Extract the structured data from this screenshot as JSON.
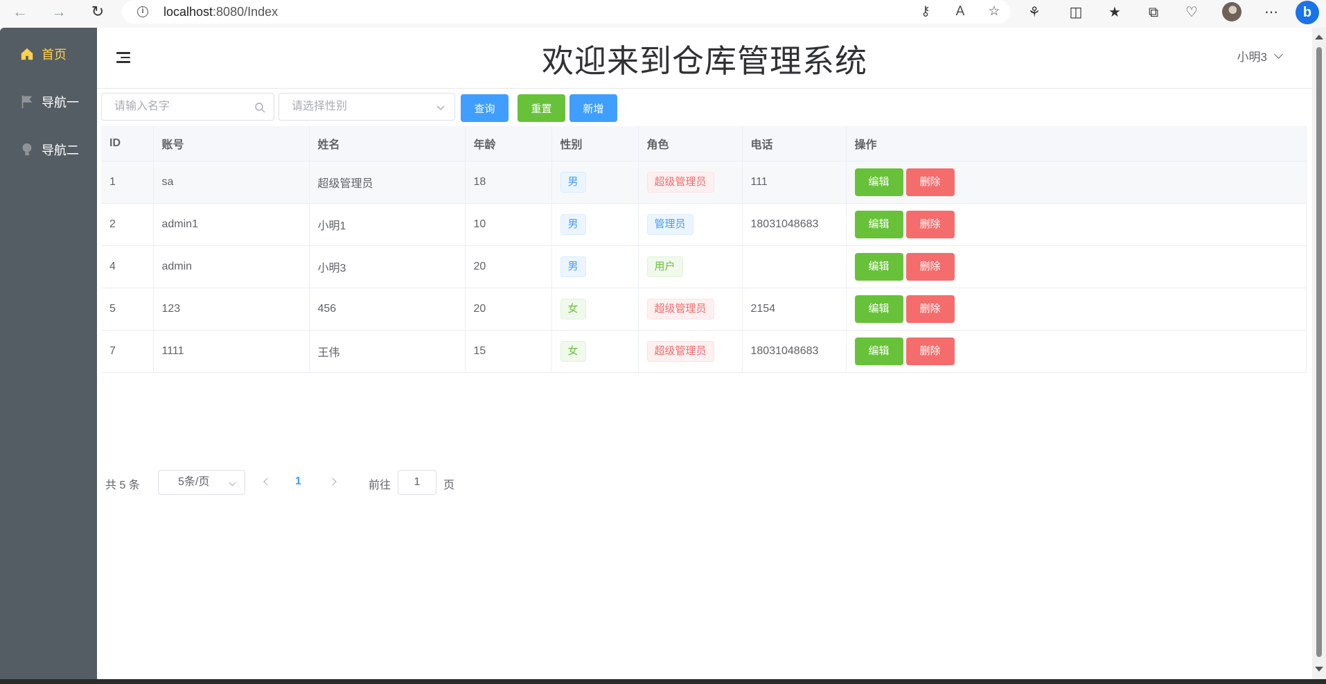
{
  "browser": {
    "url_host": "localhost",
    "url_rest": ":8080/Index"
  },
  "sidebar": {
    "items": [
      {
        "label": "首页",
        "icon": "home-icon",
        "active": true
      },
      {
        "label": "导航一",
        "icon": "flag-icon",
        "active": false
      },
      {
        "label": "导航二",
        "icon": "lightbulb-icon",
        "active": false
      }
    ],
    "active_color": "#ffd04b",
    "bg_color": "#545c64"
  },
  "header": {
    "title": "欢迎来到仓库管理系统",
    "user": "小明3"
  },
  "toolbar": {
    "search_placeholder": "请输入名字",
    "sex_placeholder": "请选择性别",
    "query_label": "查询",
    "reset_label": "重置",
    "add_label": "新增"
  },
  "table": {
    "columns": [
      "ID",
      "账号",
      "姓名",
      "年龄",
      "性别",
      "角色",
      "电话",
      "操作"
    ],
    "rows": [
      {
        "id": "1",
        "account": "sa",
        "name": "超级管理员",
        "age": "18",
        "sex": "男",
        "role": "超级管理员",
        "phone": "111"
      },
      {
        "id": "2",
        "account": "admin1",
        "name": "小明1",
        "age": "10",
        "sex": "男",
        "role": "管理员",
        "phone": "18031048683"
      },
      {
        "id": "4",
        "account": "admin",
        "name": "小明3",
        "age": "20",
        "sex": "男",
        "role": "用户",
        "phone": ""
      },
      {
        "id": "5",
        "account": "123",
        "name": "456",
        "age": "20",
        "sex": "女",
        "role": "超级管理员",
        "phone": "2154"
      },
      {
        "id": "7",
        "account": "1111",
        "name": "王伟",
        "age": "15",
        "sex": "女",
        "role": "超级管理员",
        "phone": "18031048683"
      }
    ],
    "edit_label": "编辑",
    "delete_label": "删除"
  },
  "pager": {
    "total": "共 5 条",
    "page_size": "5条/页",
    "current": "1",
    "goto_label": "前往",
    "goto_value": "1",
    "page_label": "页"
  },
  "colors": {
    "primary": "#409eff",
    "success": "#67c23a",
    "danger": "#f56c6c"
  }
}
